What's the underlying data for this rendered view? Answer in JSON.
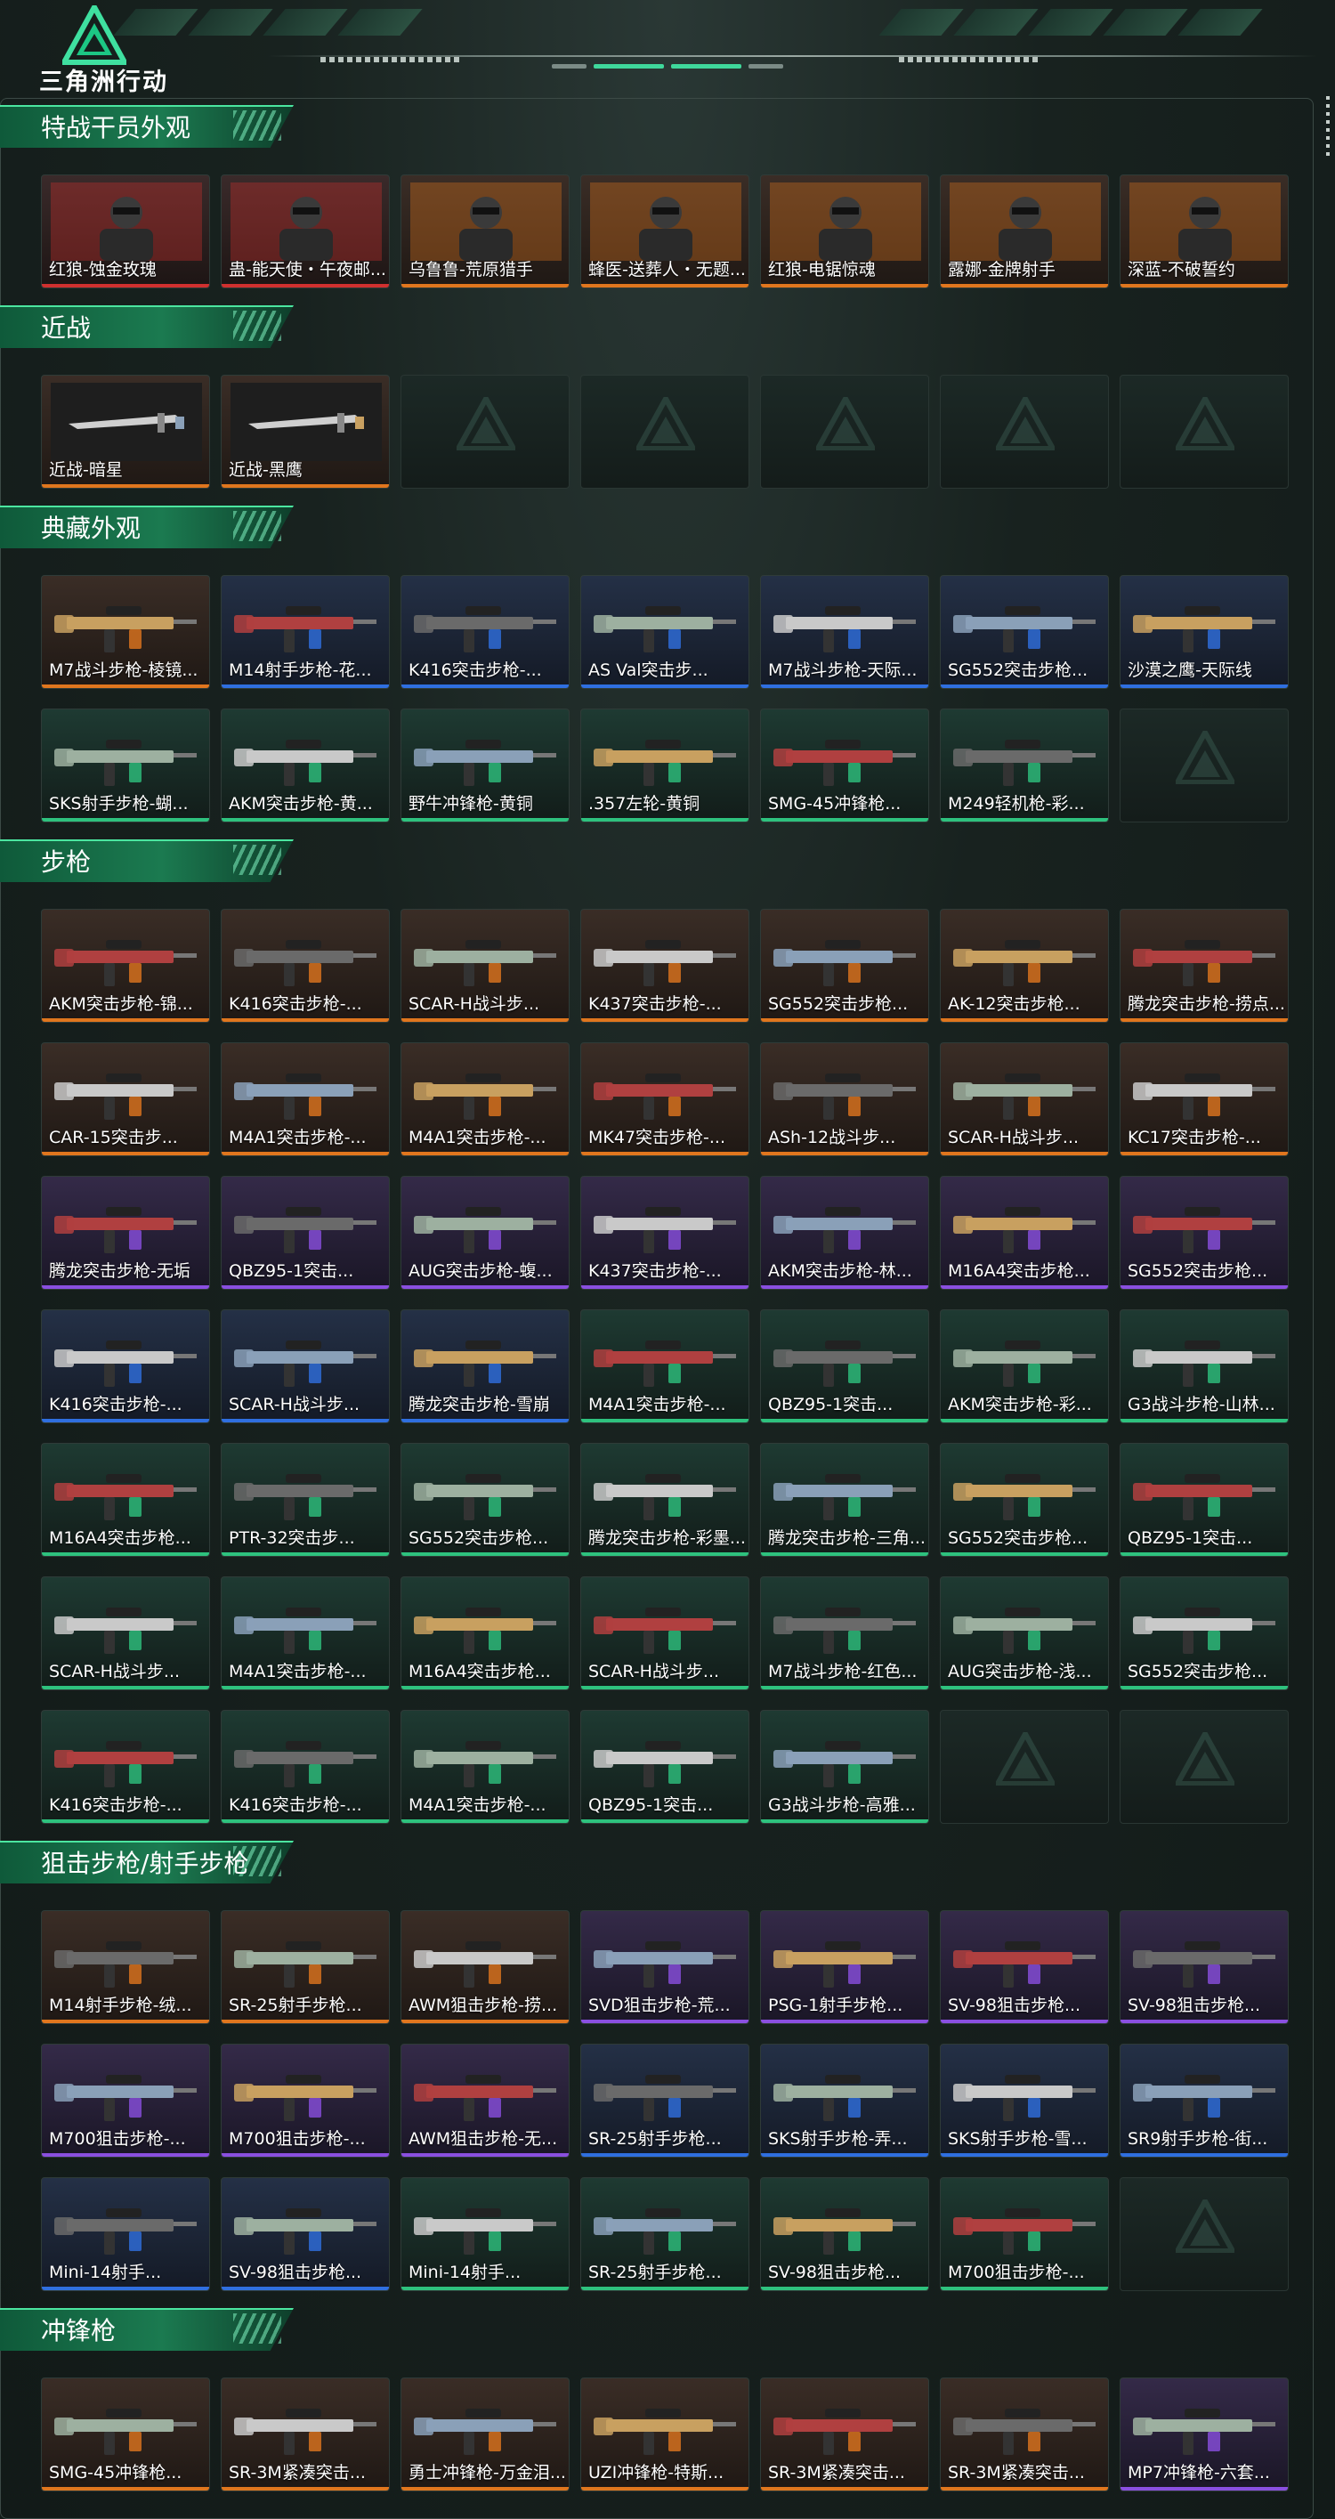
{
  "header": {
    "app_title": "三角洲行动",
    "logo_icon": "delta-logo-icon"
  },
  "colors": {
    "orange": "#e0761e",
    "purple": "#8a4fe0",
    "blue": "#2f6fe0",
    "green": "#2ec27e",
    "red": "#d0302f",
    "gray": "#7c8784"
  },
  "sections": [
    {
      "title": "特战干员外观",
      "rows": [
        [
          {
            "name": "红狼-蚀金玫瑰",
            "rarity": "red"
          },
          {
            "name": "蛊-能天使・午夜邮...",
            "rarity": "red"
          },
          {
            "name": "乌鲁鲁-荒原猎手",
            "rarity": "orange"
          },
          {
            "name": "蜂医-送葬人・无题...",
            "rarity": "orange"
          },
          {
            "name": "红狼-电锯惊魂",
            "rarity": "orange"
          },
          {
            "name": "露娜-金牌射手",
            "rarity": "orange"
          },
          {
            "name": "深蓝-不破誓约",
            "rarity": "orange"
          }
        ]
      ]
    },
    {
      "title": "近战",
      "rows": [
        [
          {
            "name": "近战-暗星",
            "rarity": "orange"
          },
          {
            "name": "近战-黑鹰",
            "rarity": "orange"
          },
          {
            "name": "",
            "rarity": "empty"
          },
          {
            "name": "",
            "rarity": "empty"
          },
          {
            "name": "",
            "rarity": "empty"
          },
          {
            "name": "",
            "rarity": "empty"
          },
          {
            "name": "",
            "rarity": "empty"
          }
        ]
      ]
    },
    {
      "title": "典藏外观",
      "rows": [
        [
          {
            "name": "M7战斗步枪-棱镜...",
            "rarity": "orange"
          },
          {
            "name": "M14射手步枪-花...",
            "rarity": "blue"
          },
          {
            "name": "K416突击步枪-...",
            "rarity": "blue"
          },
          {
            "name": "AS Val突击步...",
            "rarity": "blue"
          },
          {
            "name": "M7战斗步枪-天际...",
            "rarity": "blue"
          },
          {
            "name": "SG552突击步枪...",
            "rarity": "blue"
          },
          {
            "name": "沙漠之鹰-天际线",
            "rarity": "blue"
          }
        ],
        [
          {
            "name": "SKS射手步枪-蝴...",
            "rarity": "green"
          },
          {
            "name": "AKM突击步枪-黄...",
            "rarity": "green"
          },
          {
            "name": "野牛冲锋枪-黄铜",
            "rarity": "green"
          },
          {
            "name": ".357左轮-黄铜",
            "rarity": "green"
          },
          {
            "name": "SMG-45冲锋枪...",
            "rarity": "green"
          },
          {
            "name": "M249轻机枪-彩...",
            "rarity": "green"
          },
          {
            "name": "",
            "rarity": "empty"
          }
        ]
      ]
    },
    {
      "title": "步枪",
      "rows": [
        [
          {
            "name": "AKM突击步枪-锦...",
            "rarity": "orange"
          },
          {
            "name": "K416突击步枪-...",
            "rarity": "orange"
          },
          {
            "name": "SCAR-H战斗步...",
            "rarity": "orange"
          },
          {
            "name": "K437突击步枪-...",
            "rarity": "orange"
          },
          {
            "name": "SG552突击步枪...",
            "rarity": "orange"
          },
          {
            "name": "AK-12突击步枪...",
            "rarity": "orange"
          },
          {
            "name": "腾龙突击步枪-捞点...",
            "rarity": "orange"
          }
        ],
        [
          {
            "name": "CAR-15突击步...",
            "rarity": "orange"
          },
          {
            "name": "M4A1突击步枪-...",
            "rarity": "orange"
          },
          {
            "name": "M4A1突击步枪-...",
            "rarity": "orange"
          },
          {
            "name": "MK47突击步枪-...",
            "rarity": "orange"
          },
          {
            "name": "ASh-12战斗步...",
            "rarity": "orange"
          },
          {
            "name": "SCAR-H战斗步...",
            "rarity": "orange"
          },
          {
            "name": "KC17突击步枪-...",
            "rarity": "orange"
          }
        ],
        [
          {
            "name": "腾龙突击步枪-无垢",
            "rarity": "purple"
          },
          {
            "name": "QBZ95-1突击...",
            "rarity": "purple"
          },
          {
            "name": "AUG突击步枪-蝮...",
            "rarity": "purple"
          },
          {
            "name": "K437突击步枪-...",
            "rarity": "purple"
          },
          {
            "name": "AKM突击步枪-林...",
            "rarity": "purple"
          },
          {
            "name": "M16A4突击步枪...",
            "rarity": "purple"
          },
          {
            "name": "SG552突击步枪...",
            "rarity": "purple"
          }
        ],
        [
          {
            "name": "K416突击步枪-...",
            "rarity": "blue"
          },
          {
            "name": "SCAR-H战斗步...",
            "rarity": "blue"
          },
          {
            "name": "腾龙突击步枪-雪崩",
            "rarity": "blue"
          },
          {
            "name": "M4A1突击步枪-...",
            "rarity": "green"
          },
          {
            "name": "QBZ95-1突击...",
            "rarity": "green"
          },
          {
            "name": "AKM突击步枪-彩...",
            "rarity": "green"
          },
          {
            "name": "G3战斗步枪-山林...",
            "rarity": "green"
          }
        ],
        [
          {
            "name": "M16A4突击步枪...",
            "rarity": "green"
          },
          {
            "name": "PTR-32突击步...",
            "rarity": "green"
          },
          {
            "name": "SG552突击步枪...",
            "rarity": "green"
          },
          {
            "name": "腾龙突击步枪-彩墨...",
            "rarity": "green"
          },
          {
            "name": "腾龙突击步枪-三角...",
            "rarity": "green"
          },
          {
            "name": "SG552突击步枪...",
            "rarity": "green"
          },
          {
            "name": "QBZ95-1突击...",
            "rarity": "green"
          }
        ],
        [
          {
            "name": "SCAR-H战斗步...",
            "rarity": "green"
          },
          {
            "name": "M4A1突击步枪-...",
            "rarity": "green"
          },
          {
            "name": "M16A4突击步枪...",
            "rarity": "green"
          },
          {
            "name": "SCAR-H战斗步...",
            "rarity": "green"
          },
          {
            "name": "M7战斗步枪-红色...",
            "rarity": "green"
          },
          {
            "name": "AUG突击步枪-浅...",
            "rarity": "green"
          },
          {
            "name": "SG552突击步枪...",
            "rarity": "green"
          }
        ],
        [
          {
            "name": "K416突击步枪-...",
            "rarity": "green"
          },
          {
            "name": "K416突击步枪-...",
            "rarity": "green"
          },
          {
            "name": "M4A1突击步枪-...",
            "rarity": "green"
          },
          {
            "name": "QBZ95-1突击...",
            "rarity": "green"
          },
          {
            "name": "G3战斗步枪-高雅...",
            "rarity": "green"
          },
          {
            "name": "",
            "rarity": "empty"
          },
          {
            "name": "",
            "rarity": "empty"
          }
        ]
      ]
    },
    {
      "title": "狙击步枪/射手步枪",
      "rows": [
        [
          {
            "name": "M14射手步枪-绒...",
            "rarity": "orange"
          },
          {
            "name": "SR-25射手步枪...",
            "rarity": "orange"
          },
          {
            "name": "AWM狙击步枪-捞...",
            "rarity": "orange"
          },
          {
            "name": "SVD狙击步枪-荒...",
            "rarity": "purple"
          },
          {
            "name": "PSG-1射手步枪...",
            "rarity": "purple"
          },
          {
            "name": "SV-98狙击步枪...",
            "rarity": "purple"
          },
          {
            "name": "SV-98狙击步枪...",
            "rarity": "purple"
          }
        ],
        [
          {
            "name": "M700狙击步枪-...",
            "rarity": "purple"
          },
          {
            "name": "M700狙击步枪-...",
            "rarity": "purple"
          },
          {
            "name": "AWM狙击步枪-无...",
            "rarity": "purple"
          },
          {
            "name": "SR-25射手步枪...",
            "rarity": "blue"
          },
          {
            "name": "SKS射手步枪-弄...",
            "rarity": "blue"
          },
          {
            "name": "SKS射手步枪-雪...",
            "rarity": "blue"
          },
          {
            "name": "SR9射手步枪-街...",
            "rarity": "blue"
          }
        ],
        [
          {
            "name": "Mini-14射手...",
            "rarity": "blue"
          },
          {
            "name": "SV-98狙击步枪...",
            "rarity": "blue"
          },
          {
            "name": "Mini-14射手...",
            "rarity": "green"
          },
          {
            "name": "SR-25射手步枪...",
            "rarity": "green"
          },
          {
            "name": "SV-98狙击步枪...",
            "rarity": "green"
          },
          {
            "name": "M700狙击步枪-...",
            "rarity": "green"
          },
          {
            "name": "",
            "rarity": "empty"
          }
        ]
      ]
    },
    {
      "title": "冲锋枪",
      "rows": [
        [
          {
            "name": "SMG-45冲锋枪...",
            "rarity": "orange"
          },
          {
            "name": "SR-3M紧凑突击...",
            "rarity": "orange"
          },
          {
            "name": "勇士冲锋枪-万金泪...",
            "rarity": "orange"
          },
          {
            "name": "UZI冲锋枪-特斯...",
            "rarity": "orange"
          },
          {
            "name": "SR-3M紧凑突击...",
            "rarity": "orange"
          },
          {
            "name": "SR-3M紧凑突击...",
            "rarity": "orange"
          },
          {
            "name": "MP7冲锋枪-六套...",
            "rarity": "purple"
          }
        ]
      ]
    }
  ]
}
